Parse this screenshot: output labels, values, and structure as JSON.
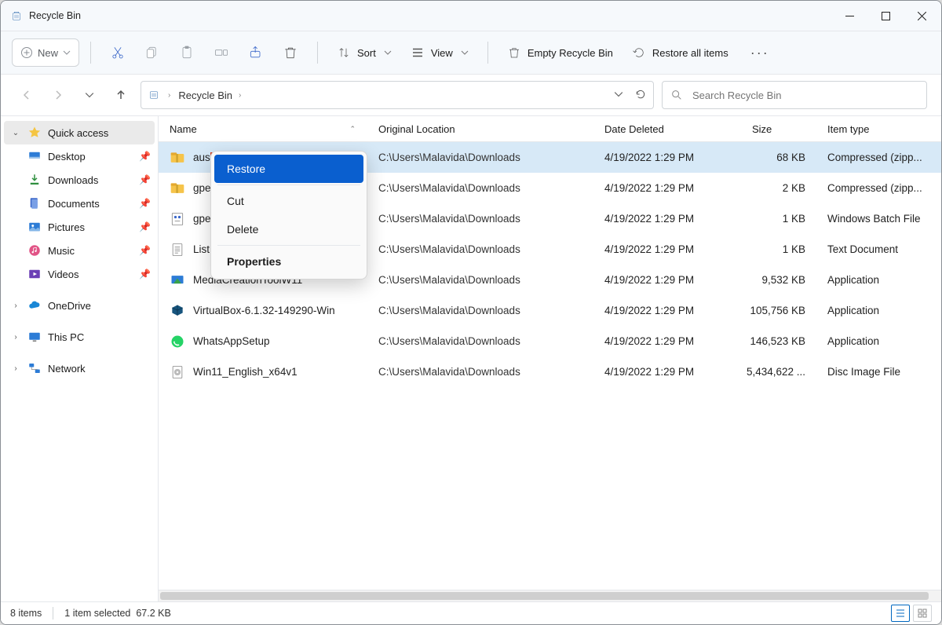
{
  "window": {
    "title": "Recycle Bin"
  },
  "toolbar": {
    "new_label": "New",
    "sort_label": "Sort",
    "view_label": "View",
    "empty_label": "Empty Recycle Bin",
    "restore_all_label": "Restore all items"
  },
  "address": {
    "location_label": "Recycle Bin"
  },
  "search": {
    "placeholder": "Search Recycle Bin"
  },
  "sidebar": {
    "quick_access_label": "Quick access",
    "onedrive_label": "OneDrive",
    "this_pc_label": "This PC",
    "network_label": "Network",
    "pinned": [
      {
        "label": "Desktop",
        "icon": "desktop"
      },
      {
        "label": "Downloads",
        "icon": "downloads"
      },
      {
        "label": "Documents",
        "icon": "documents"
      },
      {
        "label": "Pictures",
        "icon": "pictures"
      },
      {
        "label": "Music",
        "icon": "music"
      },
      {
        "label": "Videos",
        "icon": "videos"
      }
    ]
  },
  "columns": {
    "name": "Name",
    "original_location": "Original Location",
    "date_deleted": "Date Deleted",
    "size": "Size",
    "item_type": "Item type"
  },
  "files": [
    {
      "name": "austei",
      "icon": "zip",
      "location": "C:\\Users\\Malavida\\Downloads",
      "date": "4/19/2022 1:29 PM",
      "size": "68 KB",
      "type": "Compressed (zipp...",
      "selected": true
    },
    {
      "name": "gpedi",
      "icon": "zip",
      "location": "C:\\Users\\Malavida\\Downloads",
      "date": "4/19/2022 1:29 PM",
      "size": "2 KB",
      "type": "Compressed (zipp..."
    },
    {
      "name": "gpedi",
      "icon": "bat",
      "location": "C:\\Users\\Malavida\\Downloads",
      "date": "4/19/2022 1:29 PM",
      "size": "1 KB",
      "type": "Windows Batch File"
    },
    {
      "name": "List",
      "icon": "txt",
      "location": "C:\\Users\\Malavida\\Downloads",
      "date": "4/19/2022 1:29 PM",
      "size": "1 KB",
      "type": "Text Document"
    },
    {
      "name": "MediaCreationToolW11",
      "icon": "app1",
      "location": "C:\\Users\\Malavida\\Downloads",
      "date": "4/19/2022 1:29 PM",
      "size": "9,532 KB",
      "type": "Application"
    },
    {
      "name": "VirtualBox-6.1.32-149290-Win",
      "icon": "vbox",
      "location": "C:\\Users\\Malavida\\Downloads",
      "date": "4/19/2022 1:29 PM",
      "size": "105,756 KB",
      "type": "Application"
    },
    {
      "name": "WhatsAppSetup",
      "icon": "wa",
      "location": "C:\\Users\\Malavida\\Downloads",
      "date": "4/19/2022 1:29 PM",
      "size": "146,523 KB",
      "type": "Application"
    },
    {
      "name": "Win11_English_x64v1",
      "icon": "iso",
      "location": "C:\\Users\\Malavida\\Downloads",
      "date": "4/19/2022 1:29 PM",
      "size": "5,434,622 ...",
      "type": "Disc Image File"
    }
  ],
  "context_menu": {
    "items": [
      {
        "label": "Restore",
        "selected": true
      },
      {
        "label": "Cut"
      },
      {
        "label": "Delete"
      },
      {
        "label": "Properties",
        "bold": true
      }
    ]
  },
  "status": {
    "count_text": "8 items",
    "selection_text": "1 item selected",
    "selection_size": "67.2 KB"
  }
}
